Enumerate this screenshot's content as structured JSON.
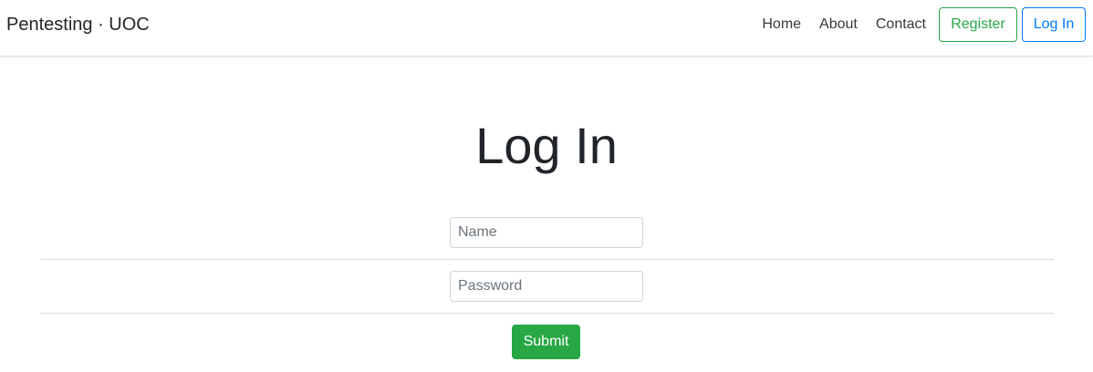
{
  "navbar": {
    "brand": "Pentesting · UOC",
    "links": [
      "Home",
      "About",
      "Contact"
    ],
    "register_label": "Register",
    "login_label": "Log In"
  },
  "main": {
    "title": "Log In",
    "name_placeholder": "Name",
    "password_placeholder": "Password",
    "submit_label": "Submit"
  },
  "colors": {
    "success": "#28a745",
    "primary": "#007bff",
    "text": "#212529"
  }
}
